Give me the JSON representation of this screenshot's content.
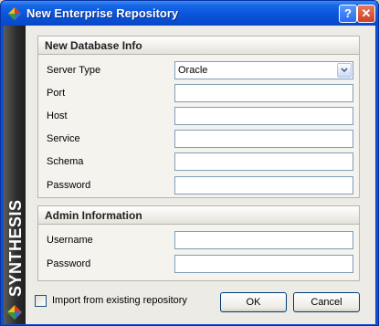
{
  "window": {
    "title": "New Enterprise Repository",
    "help_label": "?",
    "close_label": "✕"
  },
  "sidebar": {
    "brand": "SYNTHESIS"
  },
  "database_info": {
    "header": "New Database Info",
    "server_type_label": "Server Type",
    "server_type_value": "Oracle",
    "port_label": "Port",
    "port_value": "",
    "host_label": "Host",
    "host_value": "",
    "service_label": "Service",
    "service_value": "",
    "schema_label": "Schema",
    "schema_value": "",
    "password_label": "Password",
    "password_value": ""
  },
  "admin_info": {
    "header": "Admin Information",
    "username_label": "Username",
    "username_value": "",
    "password_label": "Password",
    "password_value": ""
  },
  "footer": {
    "import_label": "Import from existing repository",
    "import_checked": false,
    "ok_label": "OK",
    "cancel_label": "Cancel"
  },
  "colors": {
    "titlebar": "#0a54dc",
    "sidebar": "#2c2c2c",
    "dialog_bg": "#ecebe5"
  }
}
